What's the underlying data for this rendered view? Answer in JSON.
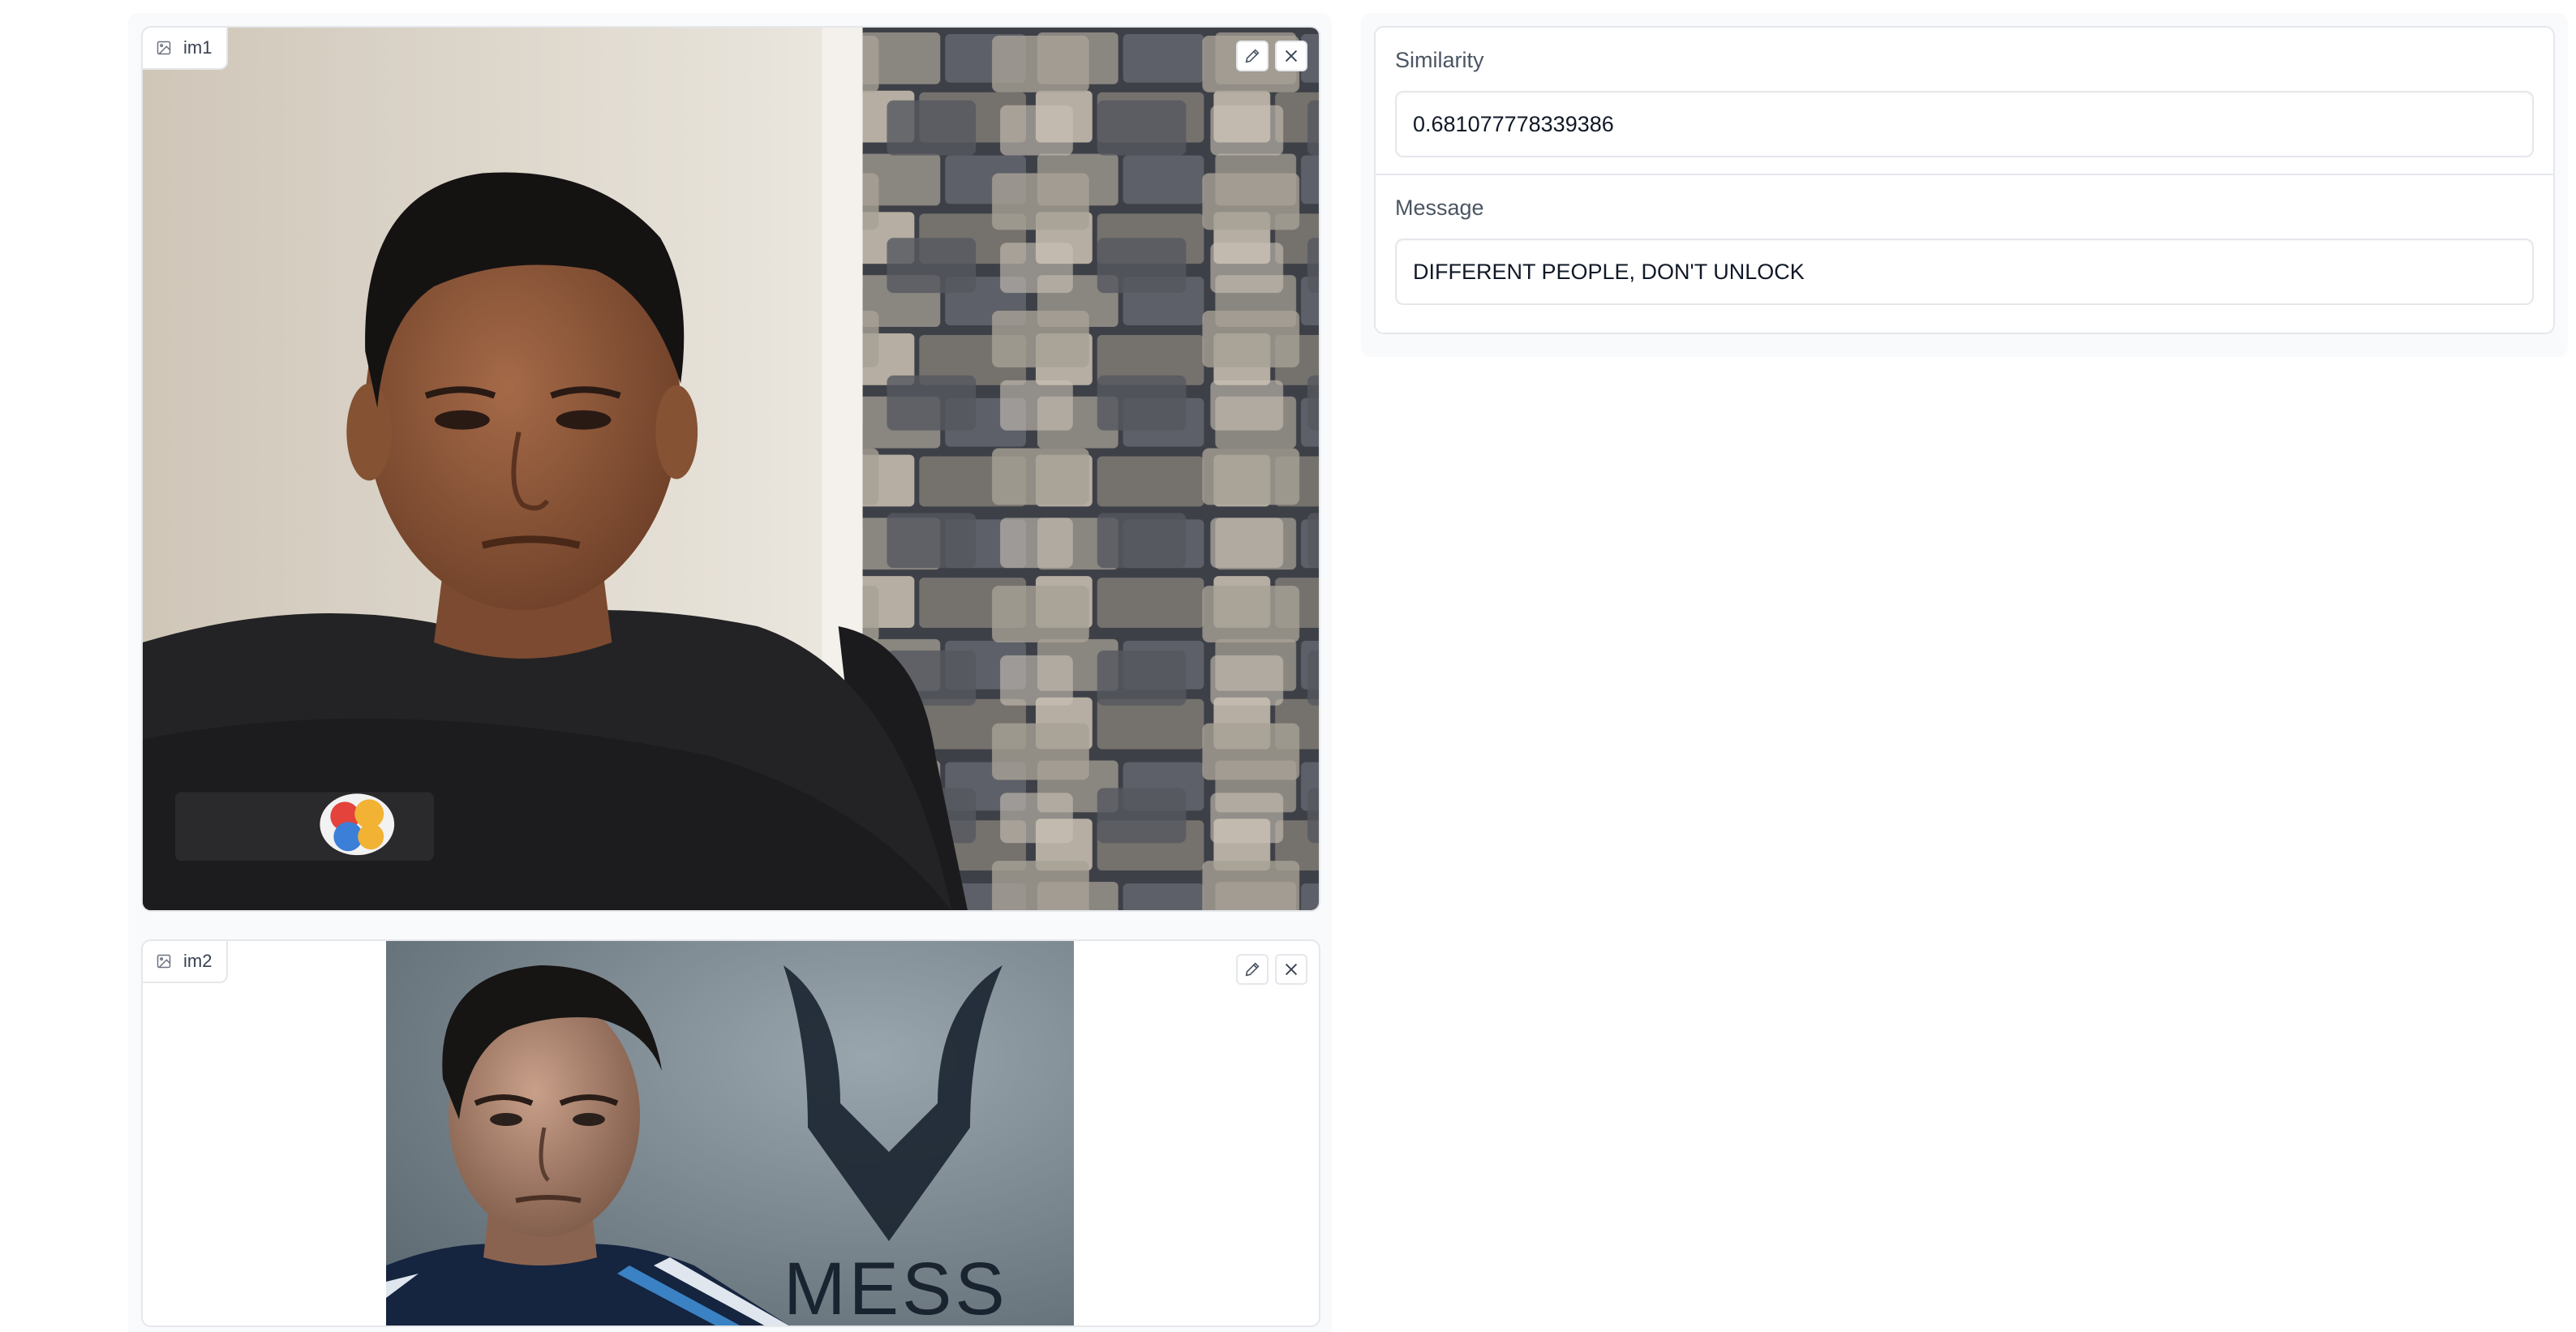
{
  "inputs": {
    "im1": {
      "label": "im1"
    },
    "im2": {
      "label": "im2",
      "logo_text": "MESS"
    }
  },
  "outputs": {
    "similarity": {
      "label": "Similarity",
      "value": "0.681077778339386"
    },
    "message": {
      "label": "Message",
      "value": "DIFFERENT PEOPLE, DON'T UNLOCK"
    }
  },
  "icons": {
    "image": "image-icon",
    "edit": "pencil-icon",
    "clear": "close-icon"
  },
  "colors": {
    "panel_bg": "#f9fafb",
    "border": "#e5e7eb",
    "label_text": "#4b5563"
  }
}
